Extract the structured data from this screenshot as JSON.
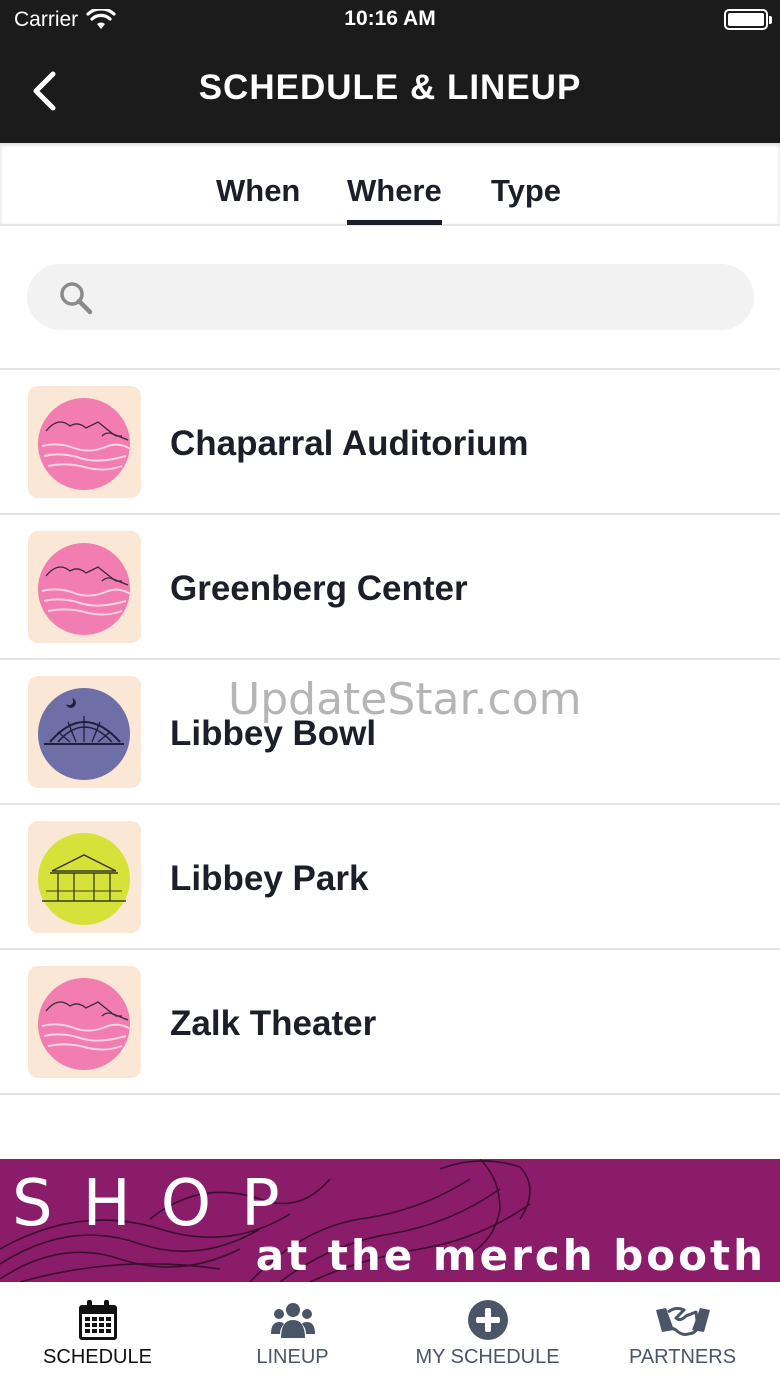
{
  "status_bar": {
    "carrier": "Carrier",
    "time": "10:16 AM"
  },
  "header": {
    "title": "SCHEDULE & LINEUP"
  },
  "tabs": [
    {
      "label": "When",
      "active": false
    },
    {
      "label": "Where",
      "active": true
    },
    {
      "label": "Type",
      "active": false
    }
  ],
  "search": {
    "placeholder": "",
    "value": ""
  },
  "venues": [
    {
      "name": "Chaparral Auditorium",
      "icon": "mountains-pink-icon"
    },
    {
      "name": "Greenberg Center",
      "icon": "mountains-pink-icon"
    },
    {
      "name": "Libbey Bowl",
      "icon": "bowl-purple-icon"
    },
    {
      "name": "Libbey Park",
      "icon": "gazebo-green-icon"
    },
    {
      "name": "Zalk Theater",
      "icon": "mountains-pink-icon"
    }
  ],
  "watermark": "UpdateStar.com",
  "banner": {
    "title": "SHOP",
    "subtitle": "at the merch booth",
    "color": "#8a1c6a"
  },
  "bottom_nav": [
    {
      "label": "SCHEDULE",
      "icon": "calendar-icon",
      "active": true
    },
    {
      "label": "LINEUP",
      "icon": "group-icon",
      "active": false
    },
    {
      "label": "MY SCHEDULE",
      "icon": "plus-circle-icon",
      "active": false
    },
    {
      "label": "PARTNERS",
      "icon": "handshake-icon",
      "active": false
    }
  ],
  "colors": {
    "header_bg": "#1b1b1b",
    "text": "#1c1f2a",
    "nav_inactive": "#4a5668"
  }
}
